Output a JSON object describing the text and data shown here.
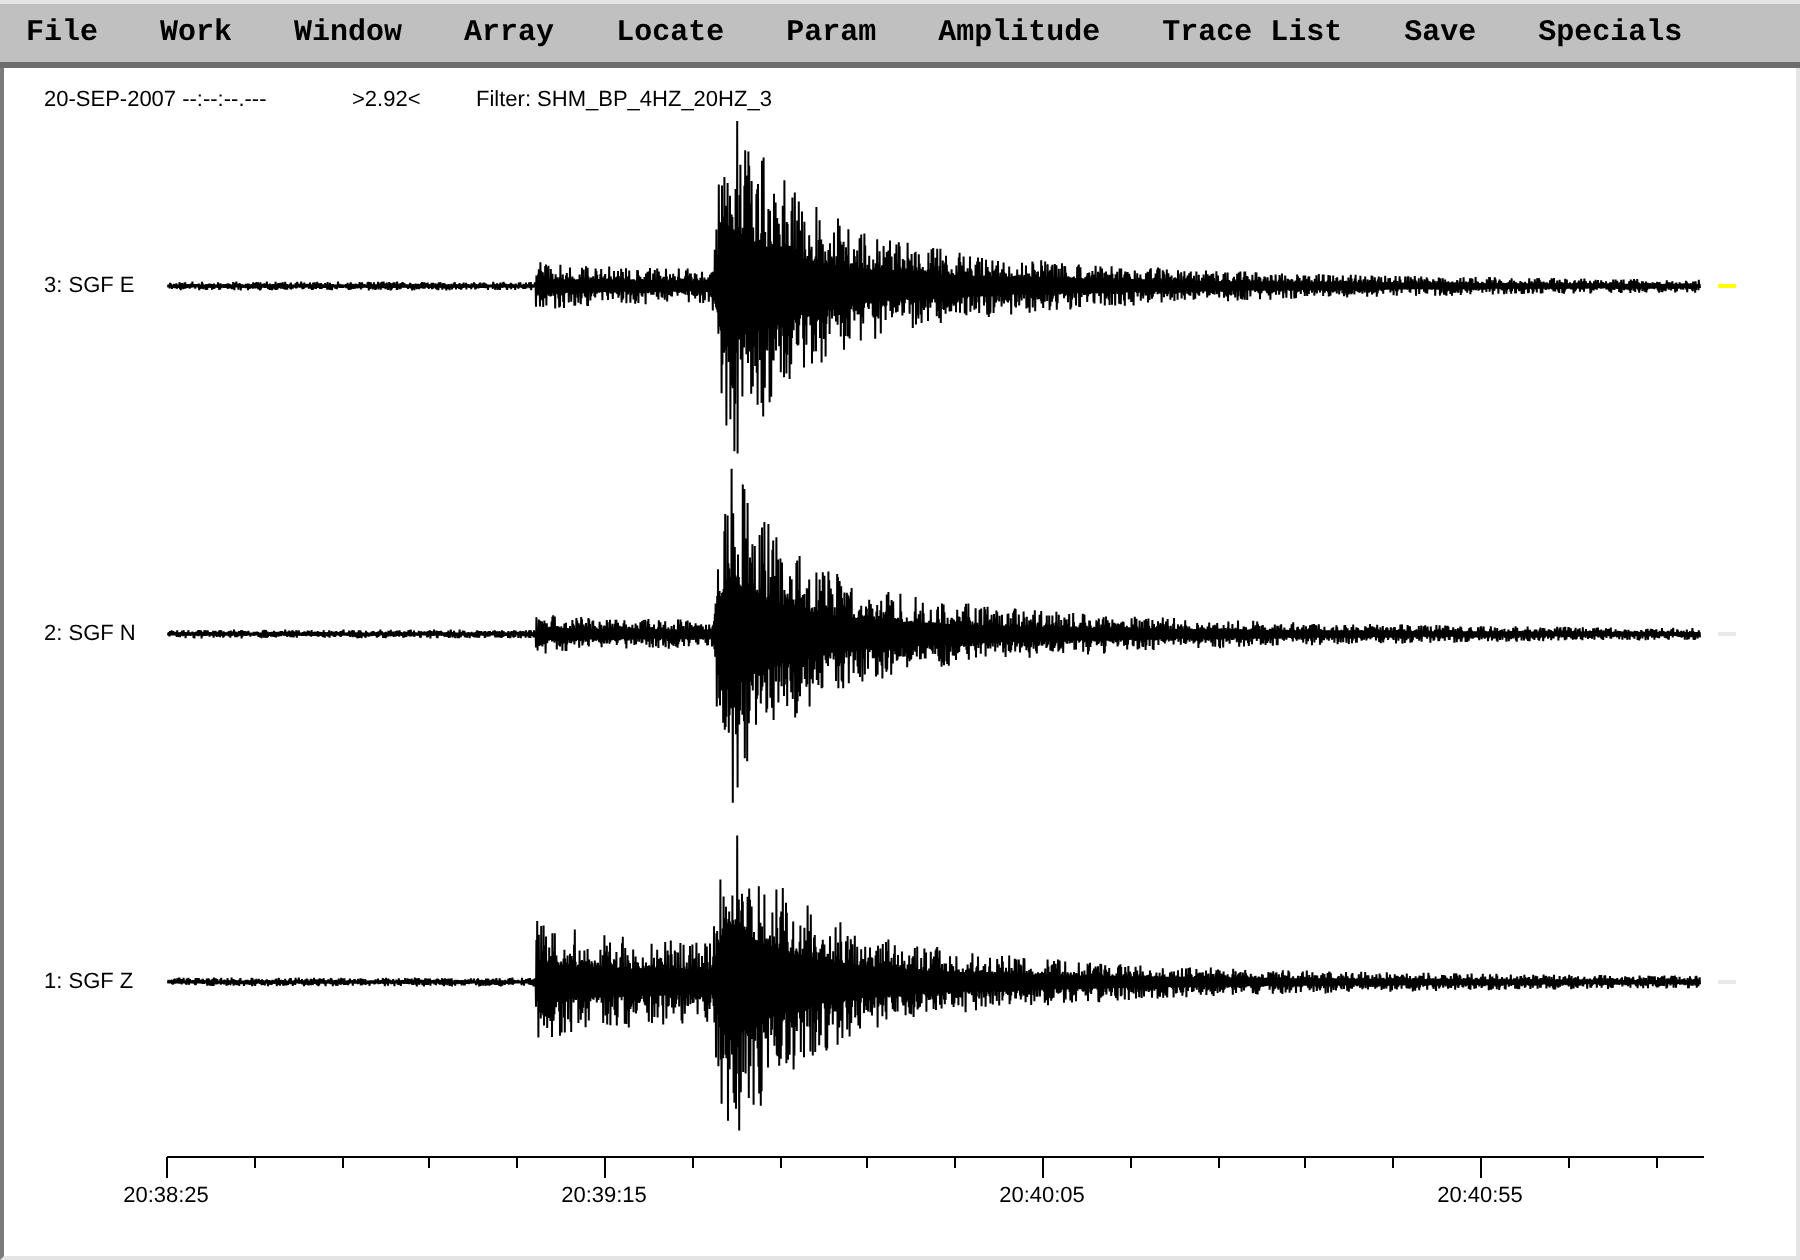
{
  "menu_bar": {
    "items": [
      "File",
      "Work",
      "Window",
      "Array",
      "Locate",
      "Param",
      "Amplitude",
      "Trace List",
      "Save",
      "Specials"
    ]
  },
  "header": {
    "date_time": "20-SEP-2007 --:--:--.---",
    "gain": ">2.92<",
    "filter": "Filter: SHM_BP_4HZ_20HZ_3"
  },
  "traces": [
    {
      "label": "3: SGF E",
      "selected": true
    },
    {
      "label": "2: SGF N",
      "selected": false
    },
    {
      "label": "1: SGF Z",
      "selected": false
    }
  ],
  "time_axis": {
    "labels": [
      "20:38:25",
      "20:39:15",
      "20:40:05",
      "20:40:55"
    ]
  }
}
